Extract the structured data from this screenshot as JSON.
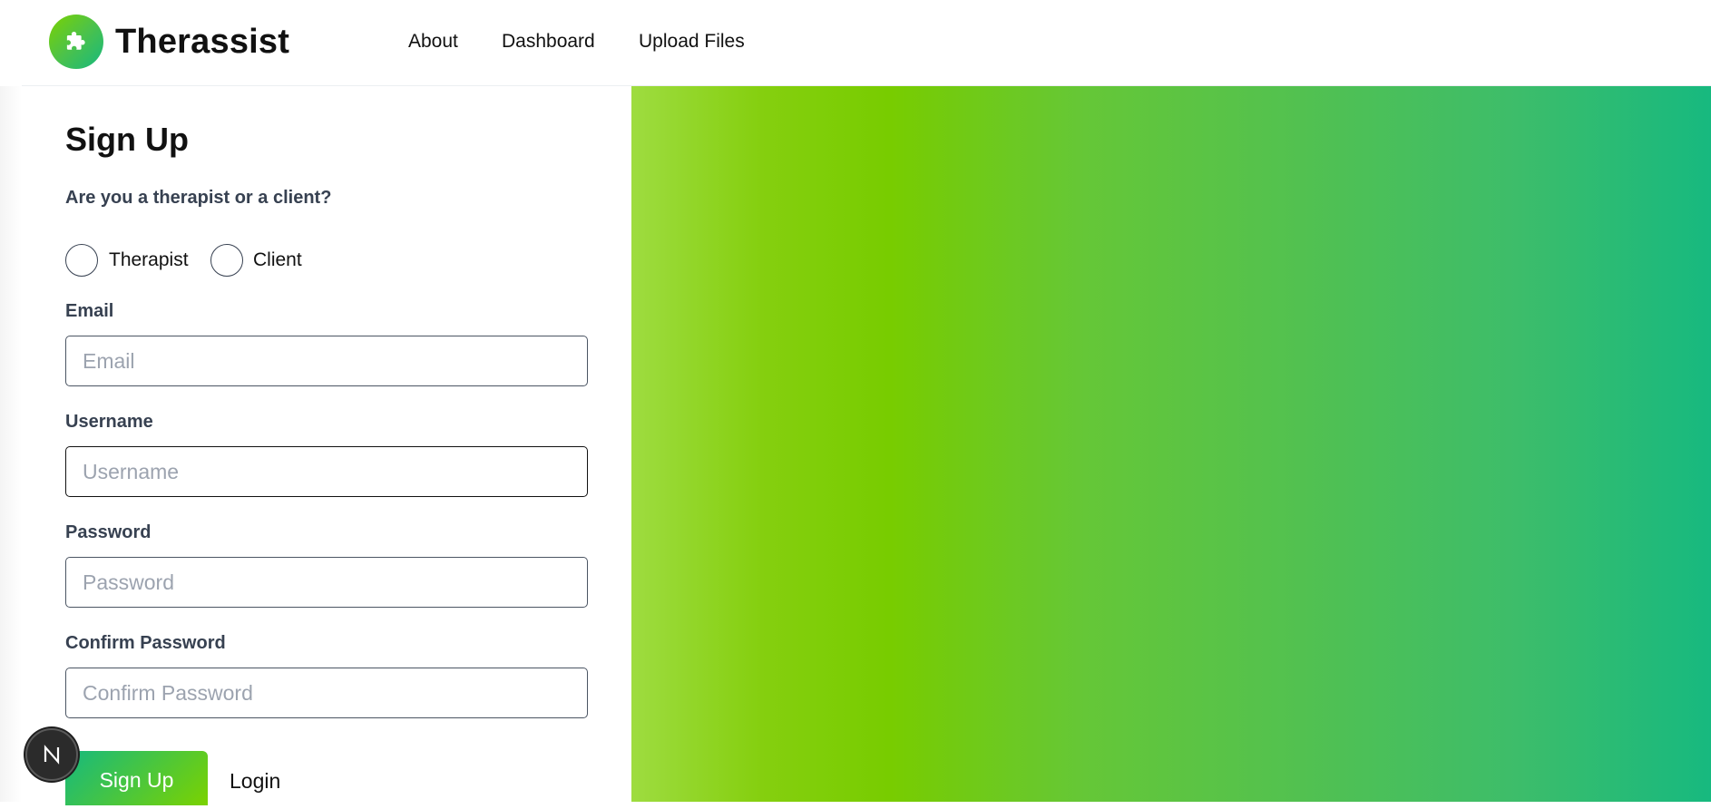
{
  "header": {
    "brand": "Therassist",
    "logo_icon": "puzzle-icon",
    "nav": [
      {
        "label": "About"
      },
      {
        "label": "Dashboard"
      },
      {
        "label": "Upload Files"
      }
    ]
  },
  "form": {
    "title": "Sign Up",
    "question": "Are you a therapist or a client?",
    "roles": [
      {
        "label": "Therapist",
        "checked": false
      },
      {
        "label": "Client",
        "checked": false
      }
    ],
    "fields": [
      {
        "label": "Email",
        "placeholder": "Email",
        "value": ""
      },
      {
        "label": "Username",
        "placeholder": "Username",
        "value": ""
      },
      {
        "label": "Password",
        "placeholder": "Password",
        "value": ""
      },
      {
        "label": "Confirm Password",
        "placeholder": "Confirm Password",
        "value": ""
      }
    ],
    "submit_label": "Sign Up",
    "login_label": "Login"
  },
  "dev_badge": {
    "icon": "nextjs-icon"
  },
  "colors": {
    "gradient_start": "#9edc40",
    "gradient_mid": "#78cc00",
    "gradient_end": "#17b97f",
    "text": "#111111",
    "label": "#374151"
  }
}
